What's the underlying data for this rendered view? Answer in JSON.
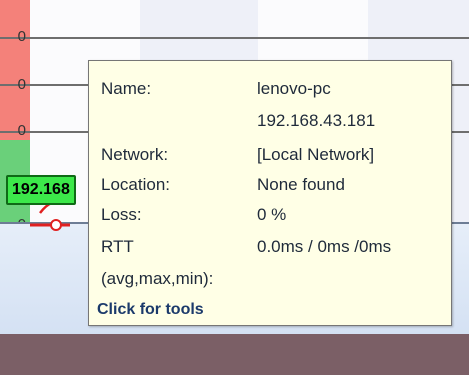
{
  "chart": {
    "y_ticks": [
      "0",
      "0",
      "0",
      "0"
    ]
  },
  "node": {
    "label": "192.168"
  },
  "tooltip": {
    "rows": [
      {
        "label": "Name:",
        "value": "lenovo-pc"
      },
      {
        "label": "",
        "value": "192.168.43.181"
      },
      {
        "label": "Network:",
        "value": "[Local Network]"
      },
      {
        "label": "Location:",
        "value": "None found"
      },
      {
        "label": "Loss:",
        "value": "0 %"
      },
      {
        "label": "RTT",
        "value": "0.0ms / 0ms /0ms"
      },
      {
        "label": "(avg,max,min):",
        "value": ""
      }
    ],
    "action": "Click for tools"
  },
  "colors": {
    "alert_red": "#f4817a",
    "ok_green": "#6ad07a",
    "node_green": "#3ce84a",
    "tooltip_bg": "#ffffe6",
    "bottom_strip": "#7b5f66"
  }
}
